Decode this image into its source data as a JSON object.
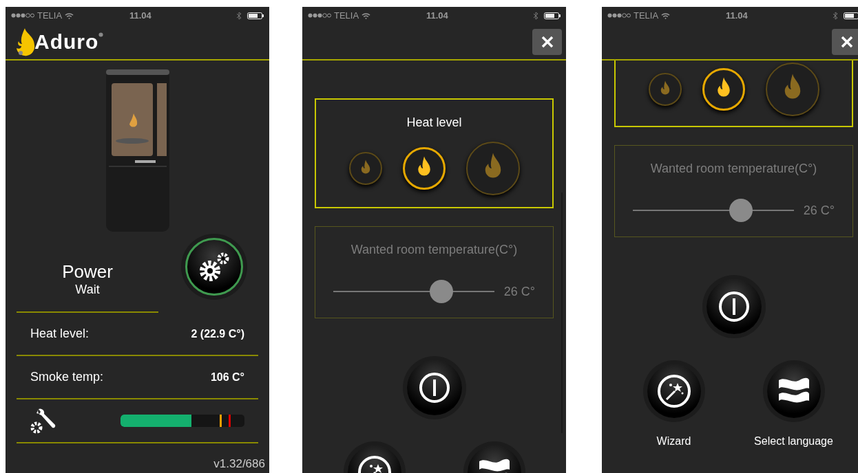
{
  "screens": [
    {
      "kind": "home",
      "status_bar": {
        "carrier": "TELIA",
        "time": "11.04"
      },
      "header": {
        "brand": "Aduro"
      },
      "status": {
        "title": "Power",
        "subtitle": "Wait"
      },
      "rows": [
        {
          "label": "Heat level:",
          "value": "2 (22.9 C°)"
        },
        {
          "label": "Smoke temp:",
          "value": "106 C°"
        }
      ],
      "service": {
        "level": 0.57
      },
      "version": "v1.32/686"
    },
    {
      "kind": "settings",
      "status_bar": {
        "carrier": "TELIA",
        "time": "11.04"
      },
      "heat_level": {
        "title": "Heat level",
        "options": [
          {
            "selected": false
          },
          {
            "selected": true
          },
          {
            "selected": false
          }
        ]
      },
      "room_temperature": {
        "title": "Wanted room temperature(C°)",
        "level": 0.67,
        "reading": "26 C°"
      },
      "actions": [
        {
          "kind": "wizard"
        },
        {
          "kind": "language"
        }
      ]
    },
    {
      "kind": "settings",
      "status_bar": {
        "carrier": "TELIA",
        "time": "11.04"
      },
      "heat_level": {
        "options": [
          {
            "selected": false
          },
          {
            "selected": true
          },
          {
            "selected": false
          }
        ]
      },
      "room_temperature": {
        "title": "Wanted room temperature(C°)",
        "level": 0.67,
        "reading": "26 C°"
      },
      "actions": [
        {
          "kind": "wizard",
          "label": "Wizard"
        },
        {
          "kind": "language",
          "label": "Select language"
        }
      ]
    }
  ]
}
